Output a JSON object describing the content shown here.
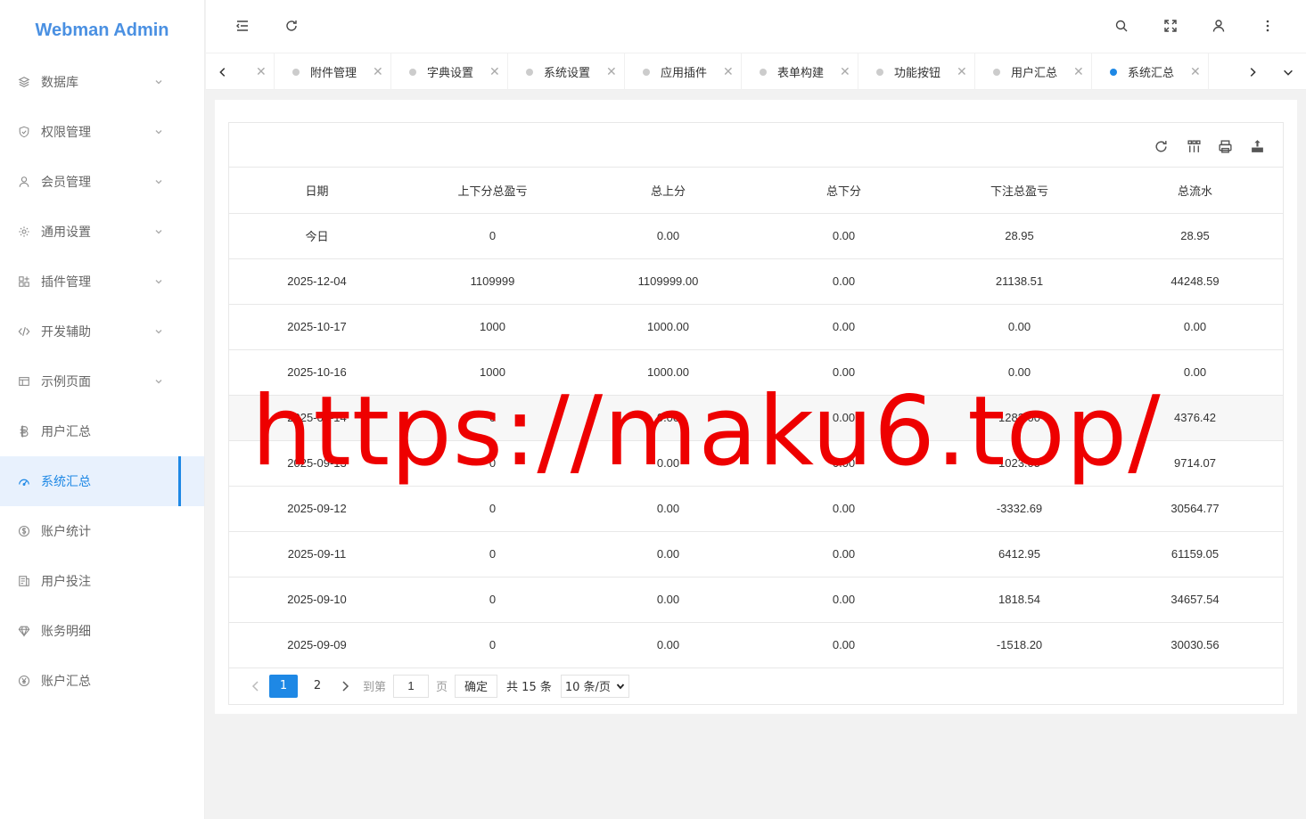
{
  "app": {
    "title": "Webman Admin"
  },
  "sidebar": {
    "items": [
      {
        "label": "数据库",
        "icon": "layers-icon",
        "has_children": true
      },
      {
        "label": "权限管理",
        "icon": "shield-icon",
        "has_children": true
      },
      {
        "label": "会员管理",
        "icon": "user-icon",
        "has_children": true
      },
      {
        "label": "通用设置",
        "icon": "gear-icon",
        "has_children": true
      },
      {
        "label": "插件管理",
        "icon": "apps-icon",
        "has_children": true
      },
      {
        "label": "开发辅助",
        "icon": "code-icon",
        "has_children": true
      },
      {
        "label": "示例页面",
        "icon": "template-icon",
        "has_children": true
      },
      {
        "label": "用户汇总",
        "icon": "currency-icon",
        "has_children": false
      },
      {
        "label": "系统汇总",
        "icon": "dashboard-icon",
        "has_children": false,
        "active": true
      },
      {
        "label": "账户统计",
        "icon": "dollar-icon",
        "has_children": false
      },
      {
        "label": "用户投注",
        "icon": "receipt-icon",
        "has_children": false
      },
      {
        "label": "账务明细",
        "icon": "diamond-icon",
        "has_children": false
      },
      {
        "label": "账户汇总",
        "icon": "yen-icon",
        "has_children": false
      }
    ]
  },
  "tabs": [
    {
      "label": "系统设置"
    },
    {
      "label": "附件管理"
    },
    {
      "label": "字典设置"
    },
    {
      "label": "系统设置"
    },
    {
      "label": "应用插件"
    },
    {
      "label": "表单构建"
    },
    {
      "label": "功能按钮"
    },
    {
      "label": "用户汇总"
    },
    {
      "label": "系统汇总",
      "active": true
    }
  ],
  "table": {
    "columns": [
      "日期",
      "上下分总盈亏",
      "总上分",
      "总下分",
      "下注总盈亏",
      "总流水"
    ],
    "rows": [
      [
        "今日",
        "0",
        "0.00",
        "0.00",
        "28.95",
        "28.95"
      ],
      [
        "2025-12-04",
        "1109999",
        "1109999.00",
        "0.00",
        "21138.51",
        "44248.59"
      ],
      [
        "2025-10-17",
        "1000",
        "1000.00",
        "0.00",
        "0.00",
        "0.00"
      ],
      [
        "2025-10-16",
        "1000",
        "1000.00",
        "0.00",
        "0.00",
        "0.00"
      ],
      [
        "2025-09-14",
        "0",
        "0.00",
        "0.00",
        "1282.00",
        "4376.42"
      ],
      [
        "2025-09-13",
        "0",
        "0.00",
        "0.00",
        "1023.05",
        "9714.07"
      ],
      [
        "2025-09-12",
        "0",
        "0.00",
        "0.00",
        "-3332.69",
        "30564.77"
      ],
      [
        "2025-09-11",
        "0",
        "0.00",
        "0.00",
        "6412.95",
        "61159.05"
      ],
      [
        "2025-09-10",
        "0",
        "0.00",
        "0.00",
        "1818.54",
        "34657.54"
      ],
      [
        "2025-09-09",
        "0",
        "0.00",
        "0.00",
        "-1518.20",
        "30030.56"
      ]
    ]
  },
  "pager": {
    "pages": [
      "1",
      "2"
    ],
    "goto_label": "到第",
    "goto_value": "1",
    "page_suffix": "页",
    "confirm_label": "确定",
    "total_label": "共 15 条",
    "page_size_label": "10 条/页"
  },
  "watermark": "https://maku6.top/",
  "colors": {
    "accent": "#1e88e5",
    "logo": "#4a90e2",
    "watermark": "#ee0000"
  }
}
